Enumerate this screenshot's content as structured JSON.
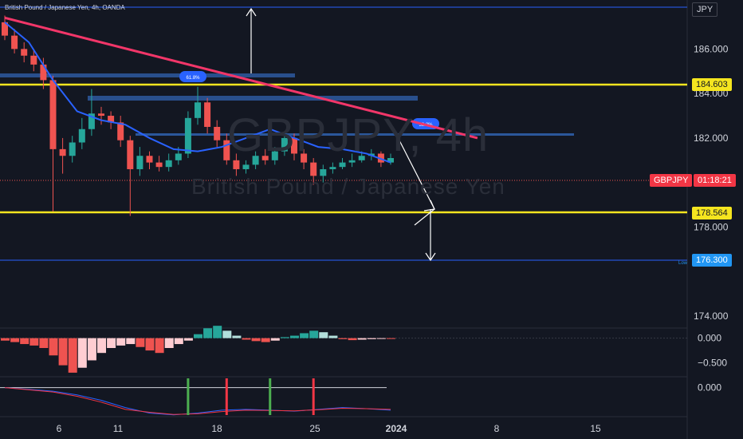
{
  "header": {
    "title": "British Pound / Japanese Yen, 4h, OANDA"
  },
  "watermark": {
    "symbol": "GBPJPY, 4h",
    "name": "British Pound / Japanese Yen"
  },
  "currency_badge": "JPY",
  "price_badges": {
    "symbol_label": "GBPJPY",
    "countdown": "01:18:21",
    "upper_level": "184.603",
    "lower_level": "178.564",
    "low_level": "176.300",
    "low_tag": "Low"
  },
  "fib_labels": {
    "upper": "61.8%",
    "right": "38.2%"
  },
  "colors": {
    "background": "#131722",
    "bull": "#26a69a",
    "bear": "#ef5350",
    "ma": "#2962ff",
    "trendline": "#f23669",
    "level": "#f5e51f",
    "zone": "#2f5ea8",
    "white": "#ffffff"
  },
  "chart_data": [
    {
      "type": "candlestick",
      "title": "British Pound / Japanese Yen, 4h, OANDA",
      "ylim": [
        173.5,
        188.2
      ],
      "y_ticks": [
        "186.000",
        "184.000",
        "182.000",
        "178.000",
        "174.000"
      ],
      "x_ticks": [
        "6",
        "11",
        "18",
        "25",
        "2024",
        "8",
        "15"
      ],
      "levels": [
        184.603,
        178.564,
        176.3
      ],
      "trendline": [
        [
          0,
          187.4
        ],
        [
          98,
          182.0
        ]
      ],
      "ma_series": {
        "x": [
          0,
          5,
          10,
          15,
          20,
          25,
          30,
          35,
          40,
          45,
          50,
          55,
          60,
          65,
          70,
          75,
          80
        ],
        "y": [
          187.2,
          186.3,
          184.6,
          183.2,
          182.8,
          182.6,
          182.0,
          181.5,
          181.4,
          181.6,
          182.0,
          182.4,
          182.0,
          181.6,
          181.5,
          181.3,
          180.9
        ]
      },
      "candles": {
        "x": [
          0,
          2,
          4,
          6,
          8,
          10,
          12,
          14,
          16,
          18,
          20,
          22,
          24,
          26,
          28,
          30,
          32,
          34,
          36,
          38,
          40,
          42,
          44,
          46,
          48,
          50,
          52,
          54,
          56,
          58,
          60,
          62,
          64,
          66,
          68,
          70,
          72,
          74,
          76,
          78,
          80
        ],
        "open": [
          187.2,
          186.6,
          186.0,
          185.7,
          185.3,
          184.6,
          181.5,
          181.2,
          181.8,
          182.4,
          183.1,
          183.0,
          182.7,
          181.9,
          180.6,
          181.2,
          180.9,
          180.7,
          181.0,
          181.3,
          182.9,
          183.6,
          182.5,
          181.9,
          181.0,
          180.6,
          180.8,
          181.2,
          181.0,
          181.4,
          182.0,
          181.3,
          180.9,
          180.3,
          180.6,
          180.7,
          180.9,
          181.0,
          181.2,
          181.3,
          180.9
        ],
        "close": [
          186.6,
          186.0,
          185.7,
          185.3,
          184.6,
          181.5,
          181.2,
          181.8,
          182.4,
          183.1,
          183.0,
          182.7,
          181.9,
          180.6,
          181.2,
          180.9,
          180.7,
          181.0,
          181.3,
          182.9,
          183.6,
          182.5,
          181.9,
          181.0,
          180.6,
          180.8,
          181.2,
          181.0,
          181.4,
          182.0,
          181.3,
          180.9,
          180.3,
          180.6,
          180.7,
          180.9,
          181.0,
          181.2,
          181.3,
          180.9,
          181.1
        ],
        "high": [
          187.5,
          186.9,
          186.3,
          186.0,
          185.6,
          184.8,
          182.0,
          182.1,
          182.9,
          184.2,
          183.4,
          183.2,
          183.0,
          182.1,
          181.6,
          181.4,
          181.2,
          181.3,
          181.6,
          183.2,
          184.3,
          183.8,
          182.8,
          182.2,
          181.3,
          181.0,
          181.4,
          181.5,
          181.6,
          182.3,
          182.2,
          181.5,
          181.1,
          180.8,
          180.9,
          181.1,
          181.3,
          181.4,
          181.5,
          181.4,
          181.3
        ],
        "low": [
          186.4,
          185.8,
          185.4,
          185.0,
          184.2,
          178.7,
          180.4,
          180.9,
          181.5,
          182.1,
          182.6,
          182.4,
          181.6,
          178.5,
          180.3,
          180.6,
          180.5,
          180.5,
          180.8,
          181.1,
          182.6,
          182.2,
          181.6,
          180.8,
          180.3,
          180.4,
          180.6,
          180.8,
          180.8,
          181.2,
          181.0,
          180.6,
          179.9,
          180.0,
          180.4,
          180.6,
          180.7,
          180.9,
          181.0,
          180.7,
          180.8
        ]
      }
    },
    {
      "type": "bar",
      "title": "",
      "ylim": [
        -0.75,
        0.35
      ],
      "y_ticks": [
        "0.000",
        "−0.500"
      ],
      "x": [
        0,
        2,
        4,
        6,
        8,
        10,
        12,
        14,
        16,
        18,
        20,
        22,
        24,
        26,
        28,
        30,
        32,
        34,
        36,
        38,
        40,
        42,
        44,
        46,
        48,
        50,
        52,
        54,
        56,
        58,
        60,
        62,
        64,
        66,
        68,
        70,
        72,
        74,
        76,
        78,
        80
      ],
      "values": [
        -0.05,
        -0.08,
        -0.12,
        -0.15,
        -0.2,
        -0.35,
        -0.55,
        -0.7,
        -0.6,
        -0.45,
        -0.3,
        -0.2,
        -0.15,
        -0.12,
        -0.18,
        -0.25,
        -0.3,
        -0.2,
        -0.12,
        -0.05,
        0.08,
        0.2,
        0.25,
        0.15,
        0.05,
        -0.03,
        -0.06,
        -0.08,
        -0.05,
        0.02,
        0.05,
        0.1,
        0.15,
        0.12,
        0.05,
        -0.02,
        -0.04,
        -0.03,
        -0.02,
        -0.01,
        -0.01
      ]
    },
    {
      "type": "line",
      "title": "",
      "ylim": [
        -0.8,
        0.3
      ],
      "y_ticks": [
        "0.000"
      ],
      "x": [
        0,
        5,
        10,
        15,
        20,
        25,
        30,
        35,
        40,
        45,
        50,
        55,
        60,
        65,
        70,
        75,
        80
      ],
      "series": [
        {
          "values": [
            0.0,
            -0.05,
            -0.1,
            -0.2,
            -0.35,
            -0.55,
            -0.7,
            -0.75,
            -0.7,
            -0.62,
            -0.6,
            -0.62,
            -0.65,
            -0.6,
            -0.55,
            -0.58,
            -0.62
          ]
        },
        {
          "values": [
            0.0,
            -0.06,
            -0.12,
            -0.24,
            -0.4,
            -0.6,
            -0.68,
            -0.74,
            -0.72,
            -0.66,
            -0.62,
            -0.63,
            -0.64,
            -0.61,
            -0.57,
            -0.58,
            -0.6
          ]
        }
      ],
      "signals": [
        {
          "x": 38,
          "dir": "bull"
        },
        {
          "x": 46,
          "dir": "bear"
        },
        {
          "x": 55,
          "dir": "bull"
        },
        {
          "x": 64,
          "dir": "bear"
        }
      ]
    }
  ]
}
